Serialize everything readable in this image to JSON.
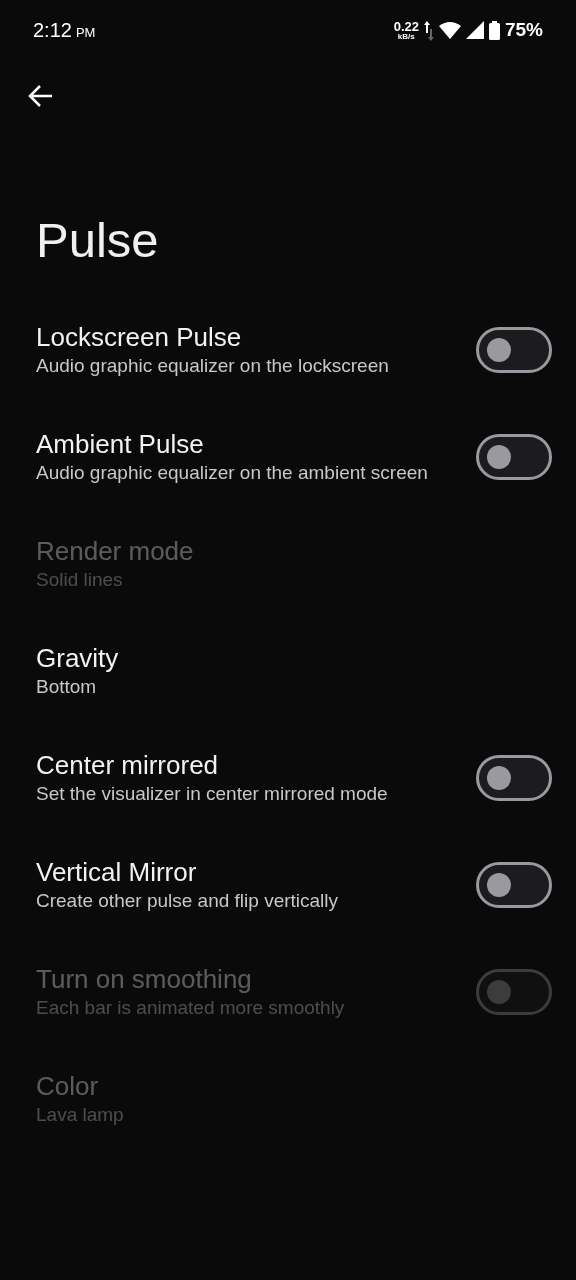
{
  "status_bar": {
    "time": "2:12",
    "ampm": "PM",
    "net_speed": "0.22",
    "net_unit": "kB/s",
    "battery": "75%"
  },
  "title": "Pulse",
  "items": [
    {
      "kind": "switch",
      "title": "Lockscreen Pulse",
      "summary": "Audio graphic equalizer on the lockscreen",
      "on": false,
      "disabled": false
    },
    {
      "kind": "switch",
      "title": "Ambient Pulse",
      "summary": "Audio graphic equalizer on the ambient screen",
      "on": false,
      "disabled": false
    },
    {
      "kind": "value",
      "title": "Render mode",
      "summary": "Solid lines",
      "disabled": true
    },
    {
      "kind": "value",
      "title": "Gravity",
      "summary": "Bottom",
      "disabled": false
    },
    {
      "kind": "switch",
      "title": "Center mirrored",
      "summary": "Set the visualizer in center mirrored mode",
      "on": false,
      "disabled": false
    },
    {
      "kind": "switch",
      "title": "Vertical Mirror",
      "summary": "Create other pulse and flip vertically",
      "on": false,
      "disabled": false
    },
    {
      "kind": "switch",
      "title": "Turn on smoothing",
      "summary": "Each bar is animated more smoothly",
      "on": false,
      "disabled": true
    },
    {
      "kind": "value",
      "title": "Color",
      "summary": "Lava lamp",
      "disabled": true
    }
  ]
}
